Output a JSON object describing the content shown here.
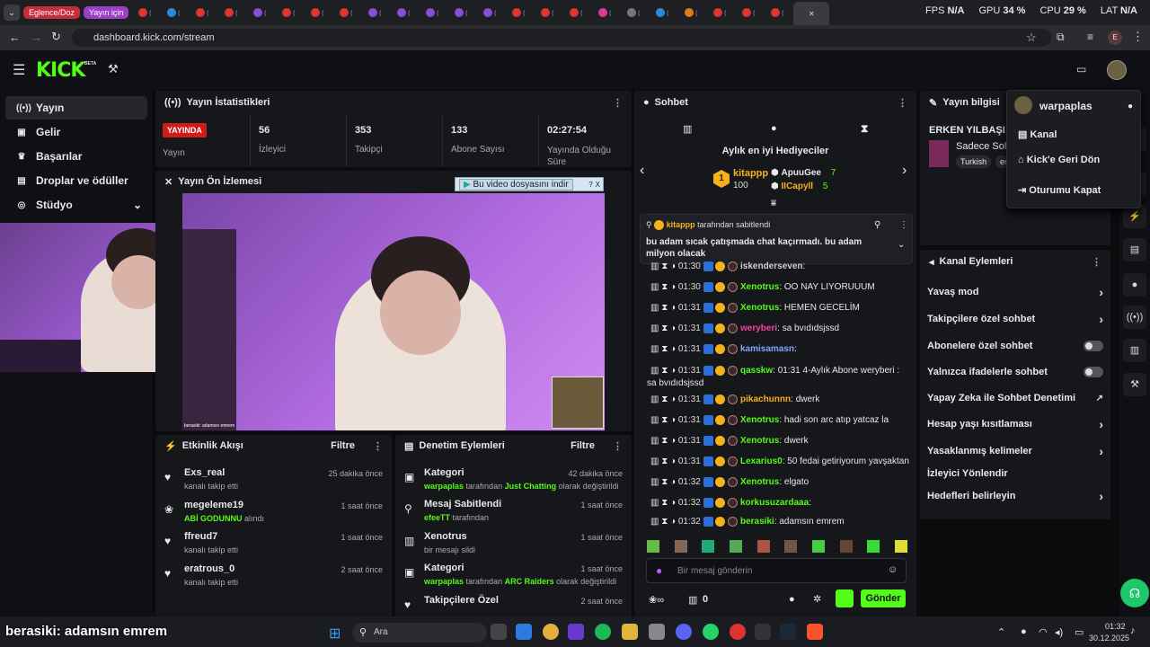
{
  "browser": {
    "tabs": {
      "pill1": "Eglence/Doz",
      "pill2": "Yayın için"
    },
    "perf": {
      "fps_label": "FPS",
      "fps_val": "N/A",
      "gpu_label": "GPU",
      "gpu_val": "34 %",
      "cpu_label": "CPU",
      "cpu_val": "29 %",
      "lat_label": "LAT",
      "lat_val": "N/A"
    },
    "url": "dashboard.kick.com/stream"
  },
  "header": {
    "logo": "KICK",
    "beta": "BETA"
  },
  "sidebar": {
    "items": [
      {
        "label": "Yayın",
        "icon": "broadcast-icon"
      },
      {
        "label": "Gelir",
        "icon": "money-icon"
      },
      {
        "label": "Başarılar",
        "icon": "trophy-icon"
      },
      {
        "label": "Droplar ve ödüller",
        "icon": "gift-icon"
      },
      {
        "label": "Stüdyo",
        "icon": "studio-icon"
      }
    ]
  },
  "stats": {
    "title": "Yayın İstatistikleri",
    "live_badge": "YAYINDA",
    "live_label": "Yayın",
    "items": [
      {
        "value": "56",
        "label": "İzleyici"
      },
      {
        "value": "353",
        "label": "Takipçi"
      },
      {
        "value": "133",
        "label": "Abone Sayısı"
      },
      {
        "value": "02:27:54",
        "label": "Yayında Olduğu Süre"
      }
    ]
  },
  "preview": {
    "title": "Yayın Ön İzlemesi",
    "download_bar": "Bu video dosyasını indir",
    "overlay_caption": "berasiki: adamsın emrem"
  },
  "activity": {
    "title": "Etkinlik Akışı",
    "filter": "Filtre",
    "items": [
      {
        "name": "Exs_real",
        "desc": "kanalı takip etti",
        "time": "25 dakika önce"
      },
      {
        "name": "megeleme19",
        "desc_highlight": "ABİ GODUNNU",
        "desc": "alındı",
        "time": "1 saat önce"
      },
      {
        "name": "ffreud7",
        "desc": "kanalı takip etti",
        "time": "1 saat önce"
      },
      {
        "name": "eratrous_0",
        "desc": "kanalı takip etti",
        "time": "2 saat önce"
      }
    ]
  },
  "moderation": {
    "title": "Denetim Eylemleri",
    "filter": "Filtre",
    "items": [
      {
        "name": "Kategori",
        "user": "warpaplas",
        "mid": "tarafından",
        "target": "Just Chatting",
        "end": "olarak değiştirildi",
        "time": "42 dakika önce"
      },
      {
        "name": "Mesaj Sabitlendi",
        "user": "efeeTT",
        "mid": "tarafından",
        "target": "",
        "end": "",
        "time": "1 saat önce"
      },
      {
        "name": "Xenotrus",
        "user": "",
        "mid": "bir mesajı sildi",
        "target": "",
        "end": "",
        "time": "1 saat önce"
      },
      {
        "name": "Kategori",
        "user": "warpaplas",
        "mid": "tarafından",
        "target": "ARC Raiders",
        "end": "olarak değiştirildi",
        "time": "1 saat önce"
      },
      {
        "name": "Takipçilere Özel",
        "user": "",
        "mid": "",
        "target": "",
        "end": "",
        "time": "2 saat önce"
      }
    ]
  },
  "chat": {
    "title": "Sohbet",
    "gifters_title": "Aylık en iyi Hediyeciler",
    "top_gifter": {
      "name": "kitappp",
      "count": "100"
    },
    "gifters": [
      {
        "name": "ApuuGee",
        "count": "7"
      },
      {
        "name": "IICapyll",
        "count": "5"
      }
    ],
    "pinned": {
      "by": "kitappp",
      "by_suffix": "tarafından sabitlendi",
      "text": "bu adam sıcak çatışmada chat kaçırmadı. bu adam milyon olacak"
    },
    "messages": [
      {
        "time": "01:30",
        "user": "iskenderseven",
        "color": "#d0d0d0",
        "text": ""
      },
      {
        "time": "01:30",
        "user": "Xenotrus",
        "color": "#53fc18",
        "text": "OO NAY LIYORUUUM"
      },
      {
        "time": "01:31",
        "user": "Xenotrus",
        "color": "#53fc18",
        "text": "HEMEN GECELİM"
      },
      {
        "time": "01:31",
        "user": "weryberi",
        "color": "#f0479a",
        "text": "sa bvıdıdsjssd"
      },
      {
        "time": "01:31",
        "user": "kamisamasn",
        "color": "#7aa8ff",
        "text": ""
      },
      {
        "time": "01:31",
        "user": "qasskw",
        "color": "#53fc18",
        "text": "01:31 4-Aylık Abone weryberi : sa bvıdıdsjssd"
      },
      {
        "time": "01:31",
        "user": "pikachunnn",
        "color": "#f3b21b",
        "text": "dwerk"
      },
      {
        "time": "01:31",
        "user": "Xenotrus",
        "color": "#53fc18",
        "text": "hadi son arc atıp yatcaz la"
      },
      {
        "time": "01:31",
        "user": "Xenotrus",
        "color": "#53fc18",
        "text": "dwerk"
      },
      {
        "time": "01:31",
        "user": "Lexarius0",
        "color": "#53fc18",
        "text": "50 fedai getiriyorum yavşaktan"
      },
      {
        "time": "01:32",
        "user": "Xenotrus",
        "color": "#53fc18",
        "text": "elgato"
      },
      {
        "time": "01:32",
        "user": "korkusuzardaaa",
        "color": "#53fc18",
        "text": ""
      },
      {
        "time": "01:32",
        "user": "berasiki",
        "color": "#53fc18",
        "text": "adamsın emrem"
      }
    ],
    "input_placeholder": "Bir mesaj gönderin",
    "points": "0",
    "send": "Gönder"
  },
  "info": {
    "title": "Yayın bilgisi",
    "stream_title": "ERKEN YILBAŞI OL",
    "category_prefix": "Sadece Sohb",
    "tag1": "Turkish",
    "tag2": "er"
  },
  "channel_actions": {
    "title": "Kanal Eylemleri",
    "items": [
      {
        "label": "Yavaş mod",
        "ctl": "arrow"
      },
      {
        "label": "Takipçilere özel sohbet",
        "ctl": "arrow"
      },
      {
        "label": "Abonelere özel sohbet",
        "ctl": "toggle"
      },
      {
        "label": "Yalnızca ifadelerle sohbet",
        "ctl": "toggle"
      },
      {
        "label": "Yapay Zeka ile Sohbet Denetimi",
        "ctl": "ext"
      },
      {
        "label": "Hesap yaşı kısıtlaması",
        "ctl": "arrow"
      },
      {
        "label": "Yasaklanmış kelimeler",
        "ctl": "arrow"
      },
      {
        "label": "İzleyici Yönlendir",
        "ctl": "none"
      },
      {
        "label": "Hedefleri belirleyin",
        "ctl": "arrow"
      }
    ]
  },
  "user_menu": {
    "username": "warpaplas",
    "items": [
      "Kanal",
      "Kick'e Geri Dön",
      "Oturumu Kapat"
    ]
  },
  "taskbar": {
    "search": "Ara",
    "time": "01:32",
    "date": "30.12.2025",
    "caption": "berasiki: adamsın emrem"
  }
}
